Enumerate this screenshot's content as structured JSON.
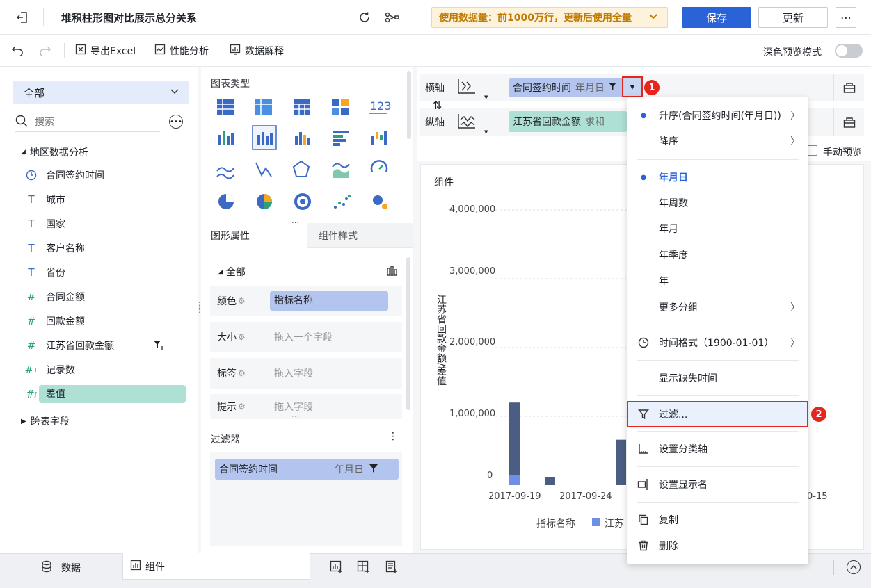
{
  "header": {
    "title": "堆积柱形图对比展示总分关系",
    "data_usage": "使用数据量：前1000万行，更新后使用全量",
    "save_label": "保存",
    "update_label": "更新"
  },
  "toolbar": {
    "export_excel": "导出Excel",
    "perf_analysis": "性能分析",
    "data_explain": "数据解释",
    "dark_preview": "深色预览模式"
  },
  "left": {
    "dataset_select": "全部",
    "search_placeholder": "搜索",
    "group_name": "地区数据分析",
    "fields": [
      {
        "label": "合同签约时间",
        "icon": "clock-icon"
      },
      {
        "label": "城市",
        "icon": "text-type-icon"
      },
      {
        "label": "国家",
        "icon": "text-type-icon"
      },
      {
        "label": "客户名称",
        "icon": "text-type-icon"
      },
      {
        "label": "省份",
        "icon": "text-type-icon"
      },
      {
        "label": "合同金额",
        "icon": "number-type-icon"
      },
      {
        "label": "回款金额",
        "icon": "number-type-icon"
      },
      {
        "label": "江苏省回款金额",
        "icon": "number-type-icon"
      },
      {
        "label": "记录数",
        "icon": "number-calc-icon"
      },
      {
        "label": "差值",
        "icon": "number-calc-icon"
      }
    ],
    "cross_fields": "跨表字段"
  },
  "middle": {
    "chart_type_title": "图表类型",
    "chart_type_123": "123",
    "tabs": {
      "shape_props": "图形属性",
      "component_style": "组件样式"
    },
    "all_label": "全部",
    "props": [
      {
        "label": "颜色",
        "value": "指标名称",
        "filled": true
      },
      {
        "label": "大小",
        "value": "拖入一个字段",
        "filled": false
      },
      {
        "label": "标签",
        "value": "拖入字段",
        "filled": false
      },
      {
        "label": "提示",
        "value": "拖入字段",
        "filled": false
      }
    ],
    "filter_title": "过滤器",
    "filter_field": "合同签约时间",
    "filter_granularity": "年月日"
  },
  "axis": {
    "x_label": "横轴",
    "y_label": "纵轴",
    "x_field": "合同签约时间",
    "x_granularity": "年月日",
    "y_field": "江苏省回款金额",
    "y_agg": "求和",
    "manual_preview": "手动预览"
  },
  "chart": {
    "component_title": "组件",
    "y_axis_label": "江苏省回款金额/差值",
    "legend_title": "指标名称",
    "legend_item": "江苏",
    "x_tick_partial": "0-15"
  },
  "chart_data": {
    "type": "bar",
    "stacked": true,
    "categories": [
      "2017-09-19",
      "",
      "",
      "2017-09-24",
      "",
      ""
    ],
    "series": [
      {
        "values": [
          150000,
          0,
          0,
          0,
          0,
          0
        ],
        "color": "#6d8fe6"
      },
      {
        "values": [
          1050000,
          120000,
          0,
          660000,
          120000,
          0
        ],
        "color": "#4b5d82"
      }
    ],
    "ylim": [
      0,
      4000000
    ],
    "yticks": [
      "4,000,000",
      "3,000,000",
      "2,000,000",
      "1,000,000",
      "0"
    ]
  },
  "menu": {
    "items": [
      {
        "label": "升序(合同签约时间(年月日))",
        "dot": true,
        "arrow": true
      },
      {
        "label": "降序",
        "dot": false,
        "arrow": true
      },
      {
        "label": "年月日",
        "dot": true,
        "arrow": false,
        "active": true
      },
      {
        "label": "年周数",
        "dot": false,
        "arrow": false
      },
      {
        "label": "年月",
        "dot": false,
        "arrow": false
      },
      {
        "label": "年季度",
        "dot": false,
        "arrow": false
      },
      {
        "label": "年",
        "dot": false,
        "arrow": false
      },
      {
        "label": "更多分组",
        "dot": false,
        "arrow": true
      },
      {
        "label": "时间格式（1900-01-01）",
        "icon": "clock-icon",
        "arrow": true
      },
      {
        "label": "显示缺失时间"
      },
      {
        "label": "过滤...",
        "icon": "filter-icon",
        "highlight": true
      },
      {
        "label": "设置分类轴",
        "icon": "axis-icon"
      },
      {
        "label": "设置显示名",
        "icon": "rename-icon"
      },
      {
        "label": "复制",
        "icon": "copy-icon"
      },
      {
        "label": "删除",
        "icon": "delete-icon"
      }
    ],
    "badge1": "1",
    "badge2": "2"
  },
  "bottom": {
    "data_tab": "数据",
    "component_tab": "组件"
  },
  "colors": {
    "primary": "#2a63d8",
    "bar_dark": "#4b5d82",
    "bar_light": "#6d8fe6",
    "highlight_red": "#e5261f"
  }
}
